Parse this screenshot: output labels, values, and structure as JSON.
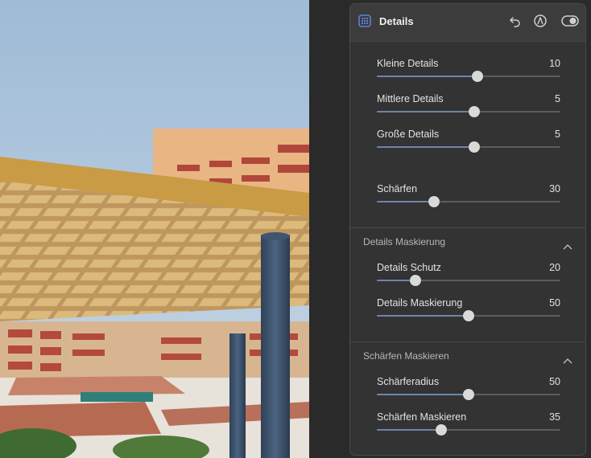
{
  "panel": {
    "title": "Details",
    "icons": [
      "grid-icon",
      "undo-icon",
      "mask-pen-icon",
      "toggle-icon"
    ]
  },
  "sliders_main": [
    {
      "label": "Kleine Details",
      "value": "10",
      "fraction": 0.55
    },
    {
      "label": "Mittlere Details",
      "value": "5",
      "fraction": 0.53
    },
    {
      "label": "Große Details",
      "value": "5",
      "fraction": 0.53
    },
    {
      "label": "Schärfen",
      "value": "30",
      "fraction": 0.31
    }
  ],
  "section_details_mask": {
    "title": "Details Maskierung",
    "sliders": [
      {
        "label": "Details Schutz",
        "value": "20",
        "fraction": 0.21
      },
      {
        "label": "Details Maskierung",
        "value": "50",
        "fraction": 0.5
      }
    ]
  },
  "section_sharpen_mask": {
    "title": "Schärfen Maskieren",
    "sliders": [
      {
        "label": "Schärferadius",
        "value": "50",
        "fraction": 0.5
      },
      {
        "label": "Schärfen Maskieren",
        "value": "35",
        "fraction": 0.35
      }
    ]
  },
  "colors": {
    "panel_bg": "#333333",
    "header_bg": "#3c3c3c",
    "slider_fill": "#6c86a8",
    "thumb": "#d9d9d9"
  }
}
